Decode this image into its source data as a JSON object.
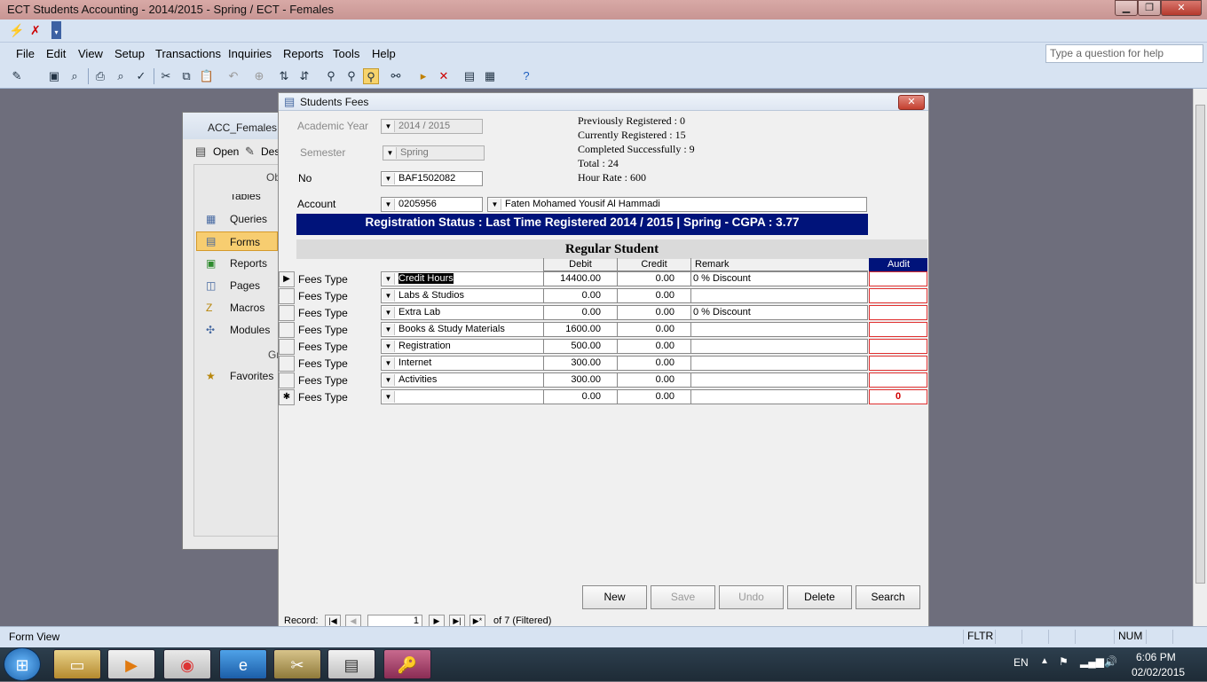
{
  "window": {
    "title": "ECT Students Accounting - 2014/2015 - Spring / ECT - Females",
    "min": "▁",
    "max": "❐",
    "close": "✕"
  },
  "menus": [
    "File",
    "Edit",
    "View",
    "Setup",
    "Transactions",
    "Inquiries",
    "Reports",
    "Tools",
    "Help"
  ],
  "help_placeholder": "Type a question for help",
  "nav": {
    "title": "ACC_Females :",
    "open": "Open",
    "design": "Des",
    "objects": "Ob",
    "groups": "Gr",
    "items": [
      "Tables",
      "Queries",
      "Forms",
      "Reports",
      "Pages",
      "Macros",
      "Modules"
    ],
    "favorites": "Favorites"
  },
  "form": {
    "title": "Students Fees",
    "academic_year_label": "Academic Year",
    "academic_year": "2014 / 2015",
    "semester_label": "Semester",
    "semester": "Spring",
    "no_label": "No",
    "no": "BAF1502082",
    "account_label": "Account",
    "account": "0205956",
    "account_name": "Faten Mohamed Yousif Al Hammadi",
    "stats": [
      "Previously Registered : 0",
      "Currently Registered : 15",
      "Completed Successfully : 9",
      "Total : 24",
      "Hour Rate : 600"
    ],
    "banner": "Registration Status :  Last Time Registered  2014 / 2015  |  Spring - CGPA : 3.77",
    "regular": "Regular Student",
    "headers": {
      "debit": "Debit",
      "credit": "Credit",
      "remark": "Remark",
      "audit": "Audit"
    },
    "rows": [
      {
        "label": "Fees Type",
        "type": "Credit Hours",
        "debit": "14400.00",
        "credit": "0.00",
        "remark": "0 % Discount",
        "audit": ""
      },
      {
        "label": "Fees Type",
        "type": "Labs & Studios",
        "debit": "0.00",
        "credit": "0.00",
        "remark": "",
        "audit": ""
      },
      {
        "label": "Fees Type",
        "type": "Extra Lab",
        "debit": "0.00",
        "credit": "0.00",
        "remark": "0 % Discount",
        "audit": ""
      },
      {
        "label": "Fees Type",
        "type": "Books & Study Materials",
        "debit": "1600.00",
        "credit": "0.00",
        "remark": "",
        "audit": ""
      },
      {
        "label": "Fees Type",
        "type": "Registration",
        "debit": "500.00",
        "credit": "0.00",
        "remark": "",
        "audit": ""
      },
      {
        "label": "Fees Type",
        "type": "Internet",
        "debit": "300.00",
        "credit": "0.00",
        "remark": "",
        "audit": ""
      },
      {
        "label": "Fees Type",
        "type": "Activities",
        "debit": "300.00",
        "credit": "0.00",
        "remark": "",
        "audit": ""
      },
      {
        "label": "Fees Type",
        "type": "",
        "debit": "0.00",
        "credit": "0.00",
        "remark": "",
        "audit": "0"
      }
    ],
    "buttons": {
      "new": "New",
      "save": "Save",
      "undo": "Undo",
      "delete": "Delete",
      "search": "Search"
    },
    "record": {
      "label": "Record:",
      "current": "1",
      "of": "of  7 (Filtered)"
    }
  },
  "status": {
    "left": "Form View",
    "fltr": "FLTR",
    "num": "NUM"
  },
  "taskbar": {
    "lang": "EN",
    "time": "6:06 PM",
    "date": "02/02/2015"
  }
}
